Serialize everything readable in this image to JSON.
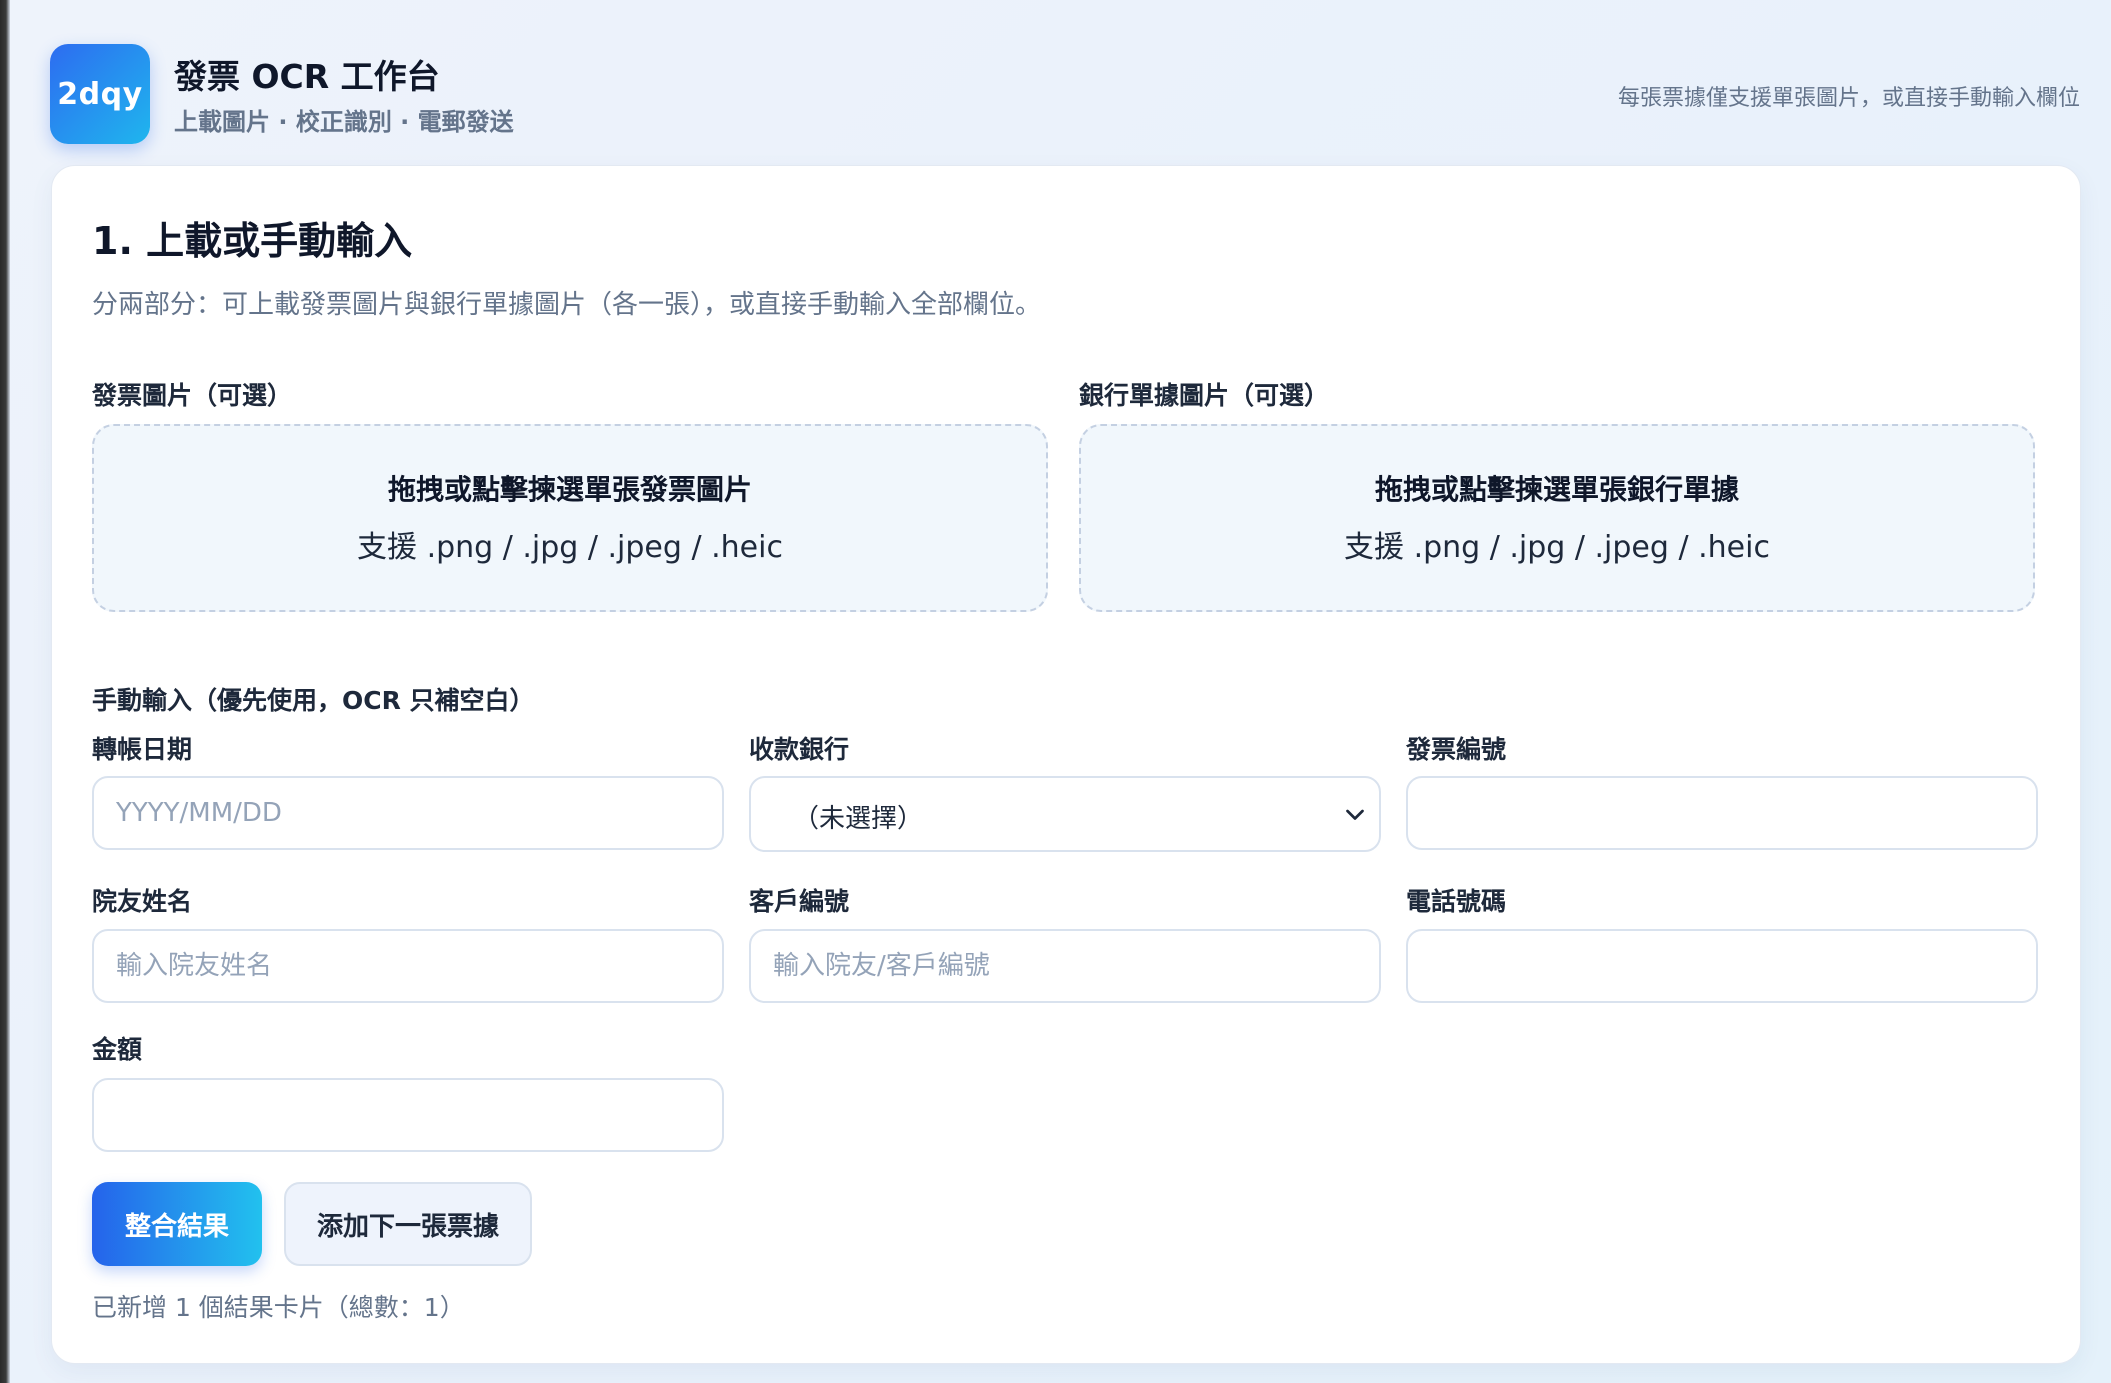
{
  "header": {
    "logo_text": "2dqy",
    "title": "發票 OCR 工作台",
    "subtitle": "上載圖片 · 校正識別 · 電郵發送",
    "note": "每張票據僅支援單張圖片，或直接手動輸入欄位"
  },
  "section": {
    "title": "1. 上載或手動輸入",
    "description": "分兩部分：可上載發票圖片與銀行單據圖片（各一張），或直接手動輸入全部欄位。"
  },
  "uploads": {
    "invoice": {
      "label": "發票圖片（可選）",
      "title": "拖拽或點擊揀選單張發票圖片",
      "formats": "支援 .png / .jpg / .jpeg / .heic"
    },
    "bank": {
      "label": "銀行單據圖片（可選）",
      "title": "拖拽或點擊揀選單張銀行單據",
      "formats": "支援 .png / .jpg / .jpeg / .heic"
    }
  },
  "manual": {
    "heading": "手動輸入（優先使用，OCR 只補空白）",
    "fields": {
      "transfer_date": {
        "label": "轉帳日期",
        "placeholder": "YYYY/MM/DD",
        "value": ""
      },
      "bank": {
        "label": "收款銀行",
        "selected": "（未選擇）"
      },
      "invoice_no": {
        "label": "發票編號",
        "placeholder": "",
        "value": ""
      },
      "alumni_name": {
        "label": "院友姓名",
        "placeholder": "輸入院友姓名",
        "value": ""
      },
      "customer_no": {
        "label": "客戶編號",
        "placeholder": "輸入院友/客戶編號",
        "value": ""
      },
      "phone": {
        "label": "電話號碼",
        "placeholder": "",
        "value": ""
      },
      "amount": {
        "label": "金額",
        "placeholder": "",
        "value": ""
      }
    }
  },
  "actions": {
    "merge_label": "整合結果",
    "add_next_label": "添加下一張票據"
  },
  "status": {
    "message": "已新增 1 個結果卡片（總數：1）"
  },
  "colors": {
    "accent_start": "#2563eb",
    "accent_end": "#22c1ee",
    "muted_text": "#64748b",
    "border": "#d9e2ee",
    "dropzone_bg": "#f1f7fc"
  }
}
